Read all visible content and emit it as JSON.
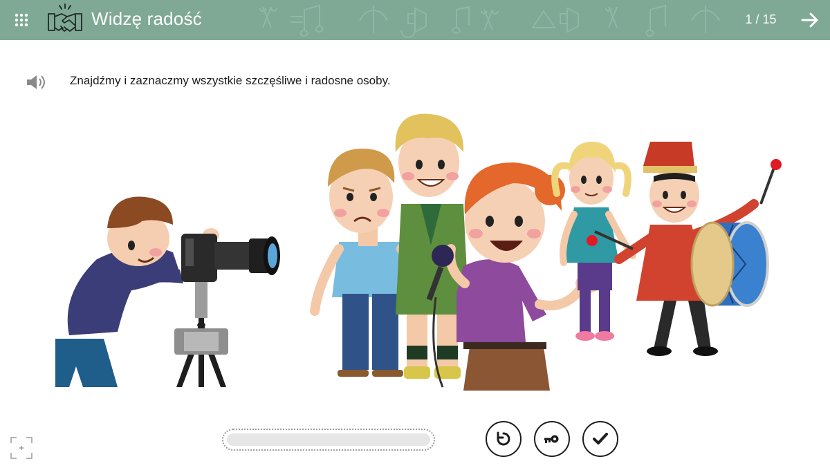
{
  "header": {
    "title": "Widzę radość",
    "page_counter": "1 / 15",
    "background_color": "#7fa895",
    "icons": {
      "menu": "grid-menu-icon",
      "logo": "handshake-icon",
      "next": "arrow-right-icon"
    }
  },
  "task": {
    "instruction": "Znajdźmy i zaznaczmy wszystkie szczęśliwe i radosne osoby.",
    "audio_icon": "speaker-icon"
  },
  "scene": {
    "figures": [
      "photographer-boy",
      "sad-boy",
      "blond-boy-scout",
      "red-haired-girl-with-microphone",
      "girl-with-pigtails",
      "drummer"
    ]
  },
  "controls": {
    "progress": 0,
    "buttons": [
      "reset-icon",
      "key-icon",
      "check-icon"
    ],
    "fullscreen_icon": "fullscreen-icon"
  }
}
